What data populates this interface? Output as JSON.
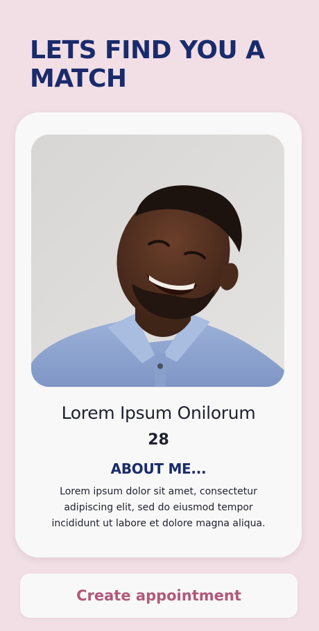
{
  "header": {
    "title": "LETS FIND YOU A MATCH"
  },
  "profile": {
    "name": "Lorem Ipsum Onilorum",
    "age": "28",
    "about_title": "ABOUT ME...",
    "about_text": "Lorem ipsum dolor sit amet, consectetur adipiscing elit, sed do eiusmod tempor incididunt ut labore et dolore magna aliqua.",
    "photo_alt": "Smiling man in a light blue polo shirt"
  },
  "actions": {
    "create_appointment": "Create appointment"
  },
  "colors": {
    "background": "#f1dfe5",
    "card": "#f8f8f8",
    "heading": "#1a2b6b",
    "accent": "#b2587a",
    "text": "#1f2030"
  }
}
